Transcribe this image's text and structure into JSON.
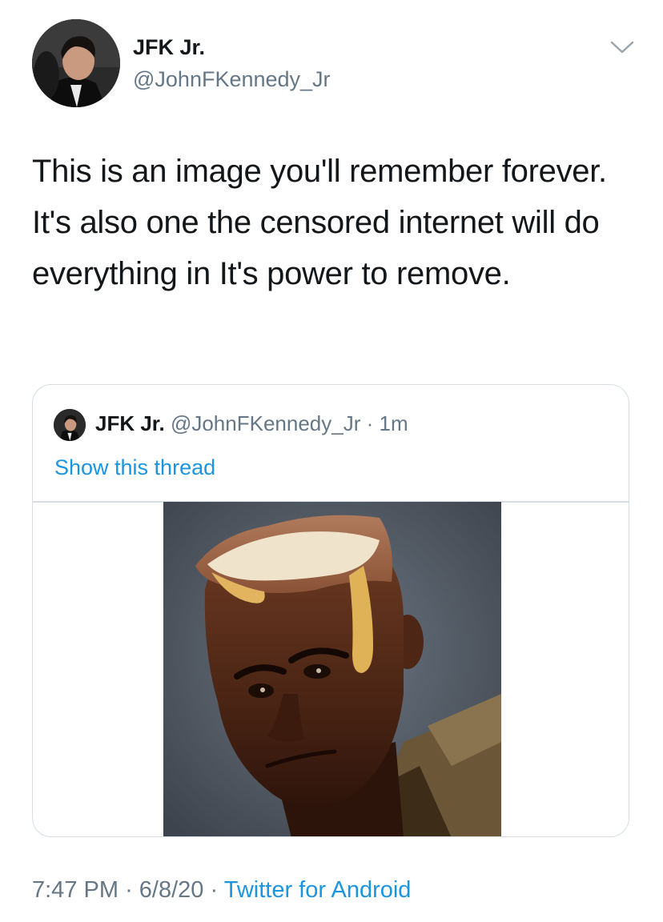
{
  "tweet": {
    "display_name": "JFK Jr.",
    "handle": "@JohnFKennedy_Jr",
    "text": "This is an image you'll remember forever. It's also one the censored internet will do everything in It's power to remove.",
    "menu_icon": "chevron-down-icon",
    "avatar_icon": "profile-photo"
  },
  "quote": {
    "display_name": "JFK Jr.",
    "handle": "@JohnFKennedy_Jr",
    "separator": "·",
    "time": "1m",
    "show_thread": "Show this thread"
  },
  "footer": {
    "time": "7:47 PM",
    "sep1": "·",
    "date": "6/8/20",
    "sep2": "·",
    "source": "Twitter for Android"
  },
  "colors": {
    "text": "#14171a",
    "secondary": "#657786",
    "link": "#1b95e0",
    "border": "#d7dde2"
  }
}
